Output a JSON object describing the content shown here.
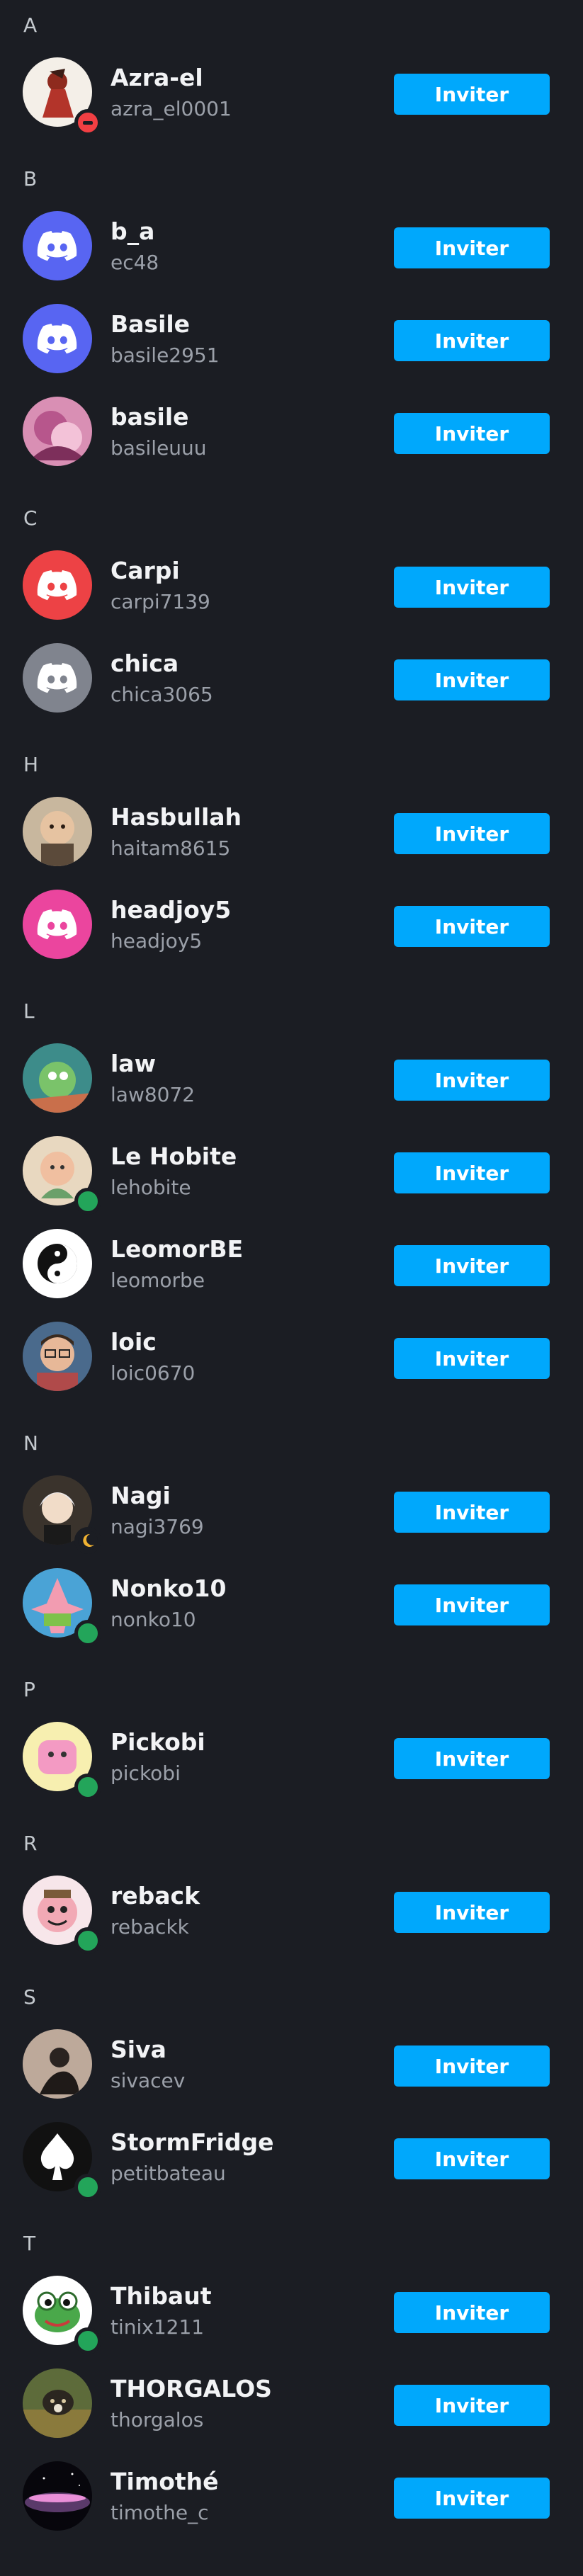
{
  "invite_label": "Inviter",
  "colors": {
    "background": "#1b1d23",
    "button": "#00a8fc",
    "online": "#23a55a",
    "dnd": "#f23f43",
    "idle": "#f0b232"
  },
  "sections": [
    {
      "letter": "A",
      "friends": [
        {
          "name": "Azra-el",
          "username": "azra_el0001",
          "avatar": "photo-red-figure",
          "status": "dnd"
        }
      ]
    },
    {
      "letter": "B",
      "friends": [
        {
          "name": "b_a",
          "username": "ec48",
          "avatar": "discord-blurple",
          "status": ""
        },
        {
          "name": "Basile",
          "username": "basile2951",
          "avatar": "discord-blurple",
          "status": ""
        },
        {
          "name": "basile",
          "username": "basileuuu",
          "avatar": "photo-pink-anime",
          "status": ""
        }
      ]
    },
    {
      "letter": "C",
      "friends": [
        {
          "name": "Carpi",
          "username": "carpi7139",
          "avatar": "discord-red",
          "status": ""
        },
        {
          "name": "chica",
          "username": "chica3065",
          "avatar": "discord-grey",
          "status": ""
        }
      ]
    },
    {
      "letter": "H",
      "friends": [
        {
          "name": "Hasbullah",
          "username": "haitam8615",
          "avatar": "photo-child",
          "status": ""
        },
        {
          "name": "headjoy5",
          "username": "headjoy5",
          "avatar": "discord-pink",
          "status": ""
        }
      ]
    },
    {
      "letter": "L",
      "friends": [
        {
          "name": "law",
          "username": "law8072",
          "avatar": "photo-cartoon-green",
          "status": ""
        },
        {
          "name": "Le Hobite",
          "username": "lehobite",
          "avatar": "photo-cartoon-beige",
          "status": "online"
        },
        {
          "name": "LeomorBE",
          "username": "leomorbe",
          "avatar": "photo-yin-yang",
          "status": ""
        },
        {
          "name": "loic",
          "username": "loic0670",
          "avatar": "photo-glasses-man",
          "status": ""
        }
      ]
    },
    {
      "letter": "N",
      "friends": [
        {
          "name": "Nagi",
          "username": "nagi3769",
          "avatar": "photo-white-hair",
          "status": "idle"
        },
        {
          "name": "Nonko10",
          "username": "nonko10",
          "avatar": "photo-patrick",
          "status": "online"
        }
      ]
    },
    {
      "letter": "P",
      "friends": [
        {
          "name": "Pickobi",
          "username": "pickobi",
          "avatar": "photo-pink-toast",
          "status": "online"
        }
      ]
    },
    {
      "letter": "R",
      "friends": [
        {
          "name": "reback",
          "username": "rebackk",
          "avatar": "photo-cartoon-face",
          "status": "online"
        }
      ]
    },
    {
      "letter": "S",
      "friends": [
        {
          "name": "Siva",
          "username": "sivacev",
          "avatar": "photo-sitting-person",
          "status": ""
        },
        {
          "name": "StormFridge",
          "username": "petitbateau",
          "avatar": "photo-spade",
          "status": "online"
        }
      ]
    },
    {
      "letter": "T",
      "friends": [
        {
          "name": "Thibaut",
          "username": "tinix1211",
          "avatar": "photo-frog",
          "status": "online"
        },
        {
          "name": "THORGALOS",
          "username": "thorgalos",
          "avatar": "photo-dog-grass",
          "status": ""
        },
        {
          "name": "Timothé",
          "username": "timothe_c",
          "avatar": "photo-planet",
          "status": ""
        }
      ]
    }
  ]
}
